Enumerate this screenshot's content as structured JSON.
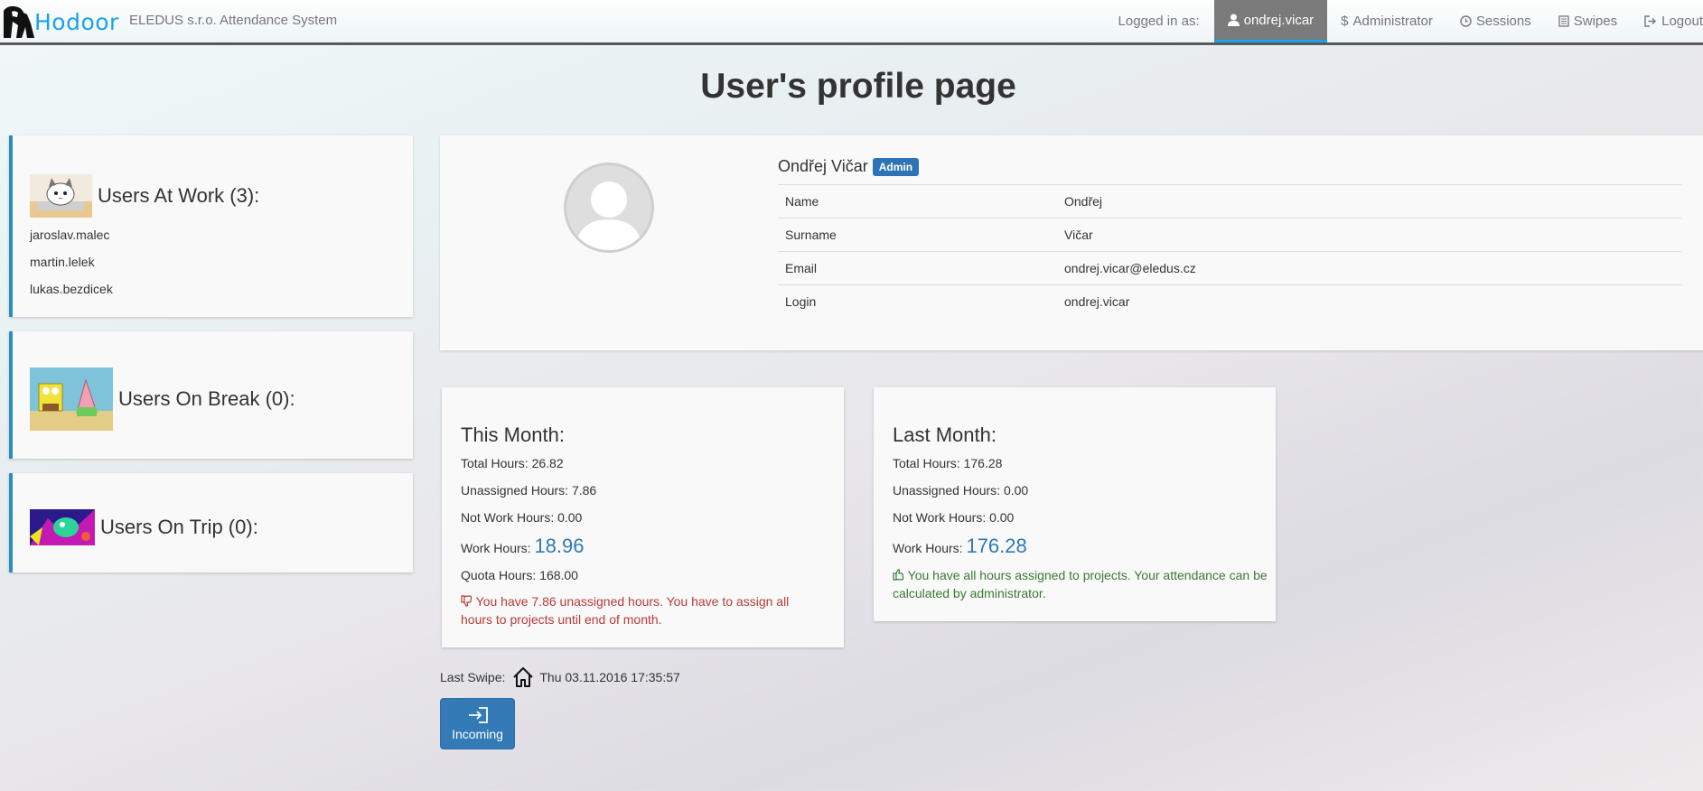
{
  "navbar": {
    "brand": "Hodoor",
    "system_title": "ELEDUS s.r.o. Attendance System",
    "logged_in_label": "Logged in as:",
    "items": [
      {
        "label": "ondrej.vicar",
        "icon": "user-icon",
        "active": true
      },
      {
        "label": "Administrator",
        "icon": "dollar-icon",
        "active": false
      },
      {
        "label": "Sessions",
        "icon": "clock-icon",
        "active": false
      },
      {
        "label": "Swipes",
        "icon": "list-icon",
        "active": false
      },
      {
        "label": "Logout",
        "icon": "logout-icon",
        "active": false
      }
    ]
  },
  "page_title": "User's profile page",
  "side": {
    "at_work": {
      "title": "Users At Work (3):",
      "users": [
        "jaroslav.malec",
        "martin.lelek",
        "lukas.bezdicek"
      ]
    },
    "on_break": {
      "title": "Users On Break (0):",
      "users": []
    },
    "on_trip": {
      "title": "Users On Trip (0):",
      "users": []
    }
  },
  "profile": {
    "display_name": "Ondřej Vičar",
    "badge": "Admin",
    "rows": [
      {
        "key": "Name",
        "value": "Ondřej"
      },
      {
        "key": "Surname",
        "value": "Vičar"
      },
      {
        "key": "Email",
        "value": "ondrej.vicar@eledus.cz"
      },
      {
        "key": "Login",
        "value": "ondrej.vicar"
      }
    ]
  },
  "this_month": {
    "title": "This Month:",
    "total": "Total Hours: 26.82",
    "unassigned": "Unassigned Hours: 7.86",
    "not_work": "Not Work Hours: 0.00",
    "work_label": "Work Hours:",
    "work_value": "18.96",
    "quota": "Quota Hours: 168.00",
    "message": "You have 7.86 unassigned hours. You have to assign all hours to projects until end of month."
  },
  "last_month": {
    "title": "Last Month:",
    "total": "Total Hours: 176.28",
    "unassigned": "Unassigned Hours: 0.00",
    "not_work": "Not Work Hours: 0.00",
    "work_label": "Work Hours:",
    "work_value": "176.28",
    "message": "You have all hours assigned to projects. Your attendance can be calculated by administrator."
  },
  "last_swipe": {
    "label": "Last Swipe:",
    "value": "Thu 03.11.2016 17:35:57"
  },
  "incoming_button": {
    "label": "Incoming"
  },
  "colors": {
    "accent": "#1aa3e8",
    "primary_button": "#337ab7",
    "danger_text": "#b73a37",
    "success_text": "#3a7a32",
    "panel_border": "#2a8fbd"
  }
}
